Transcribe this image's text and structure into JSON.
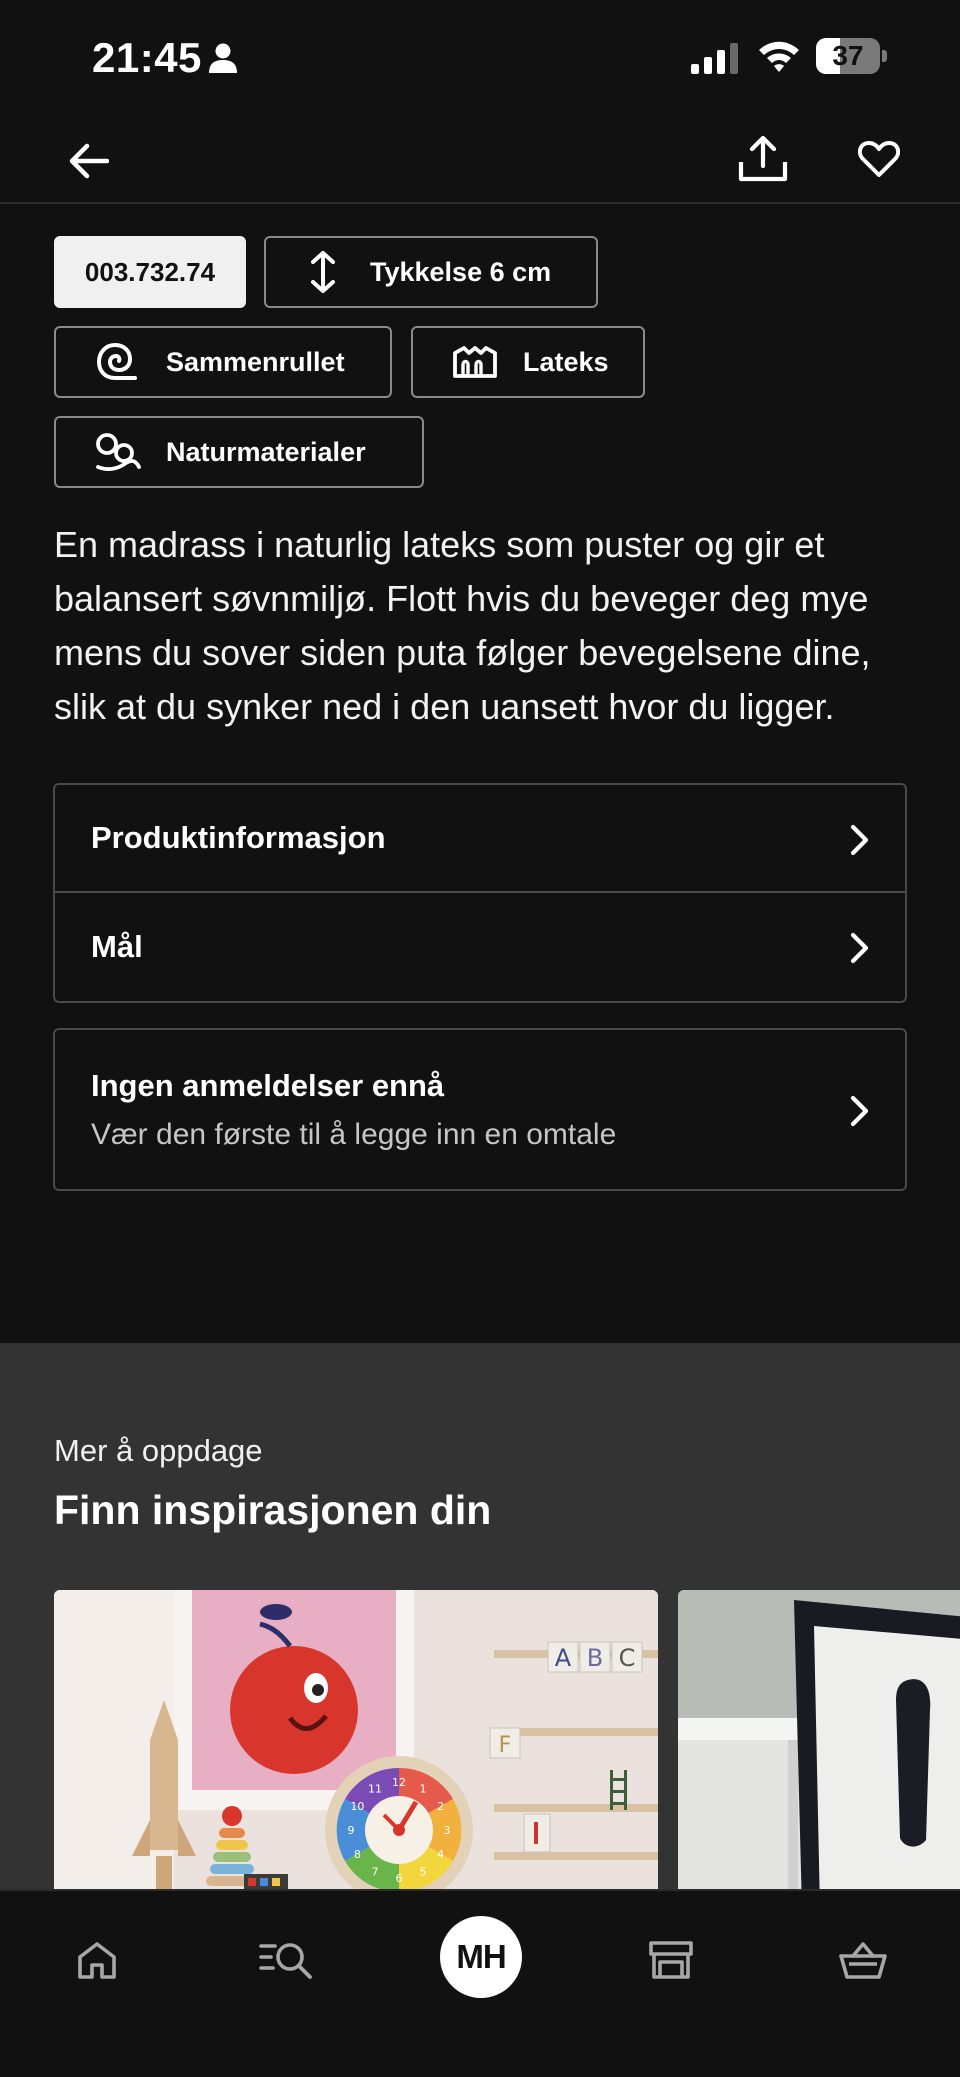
{
  "status_bar": {
    "time": "21:45",
    "battery_level": "37",
    "battery_fraction": 0.37
  },
  "app_bar": {
    "back_icon": "arrow-left-icon",
    "share_icon": "share-icon",
    "favourite_icon": "heart-icon"
  },
  "chips": {
    "article_number": "003.732.74",
    "thickness": "Tykkelse 6 cm",
    "rolled": "Sammenrullet",
    "latex": "Lateks",
    "natural": "Naturmaterialer"
  },
  "description": "En madrass i naturlig lateks som puster og gir et balansert søvnmiljø. Flott hvis du beveger deg mye mens du sover siden puta følger bevegelsene dine, slik at du synker ned i den uansett hvor du ligger.",
  "accordion": {
    "product_info": "Produktinformasjon",
    "dimensions": "Mål"
  },
  "reviews": {
    "title": "Ingen anmeldelser ennå",
    "subtitle": "Vær den første til å legge inn en omtale"
  },
  "inspiration": {
    "kicker": "Mer å oppdage",
    "title": "Finn inspirasjonen din",
    "card1_letters": [
      "A",
      "B",
      "C"
    ],
    "card1_letter_f": "F",
    "clock_numbers": [
      "12",
      "1",
      "2",
      "3",
      "4",
      "5",
      "6",
      "7",
      "8",
      "9",
      "10",
      "11"
    ]
  },
  "bottom_nav": {
    "profile_initials": "MH",
    "icons": [
      "home-icon",
      "search-icon",
      "store-icon",
      "basket-icon"
    ]
  },
  "colors": {
    "background": "#111111",
    "section_background": "#333333",
    "border": "#4a4a4a"
  }
}
